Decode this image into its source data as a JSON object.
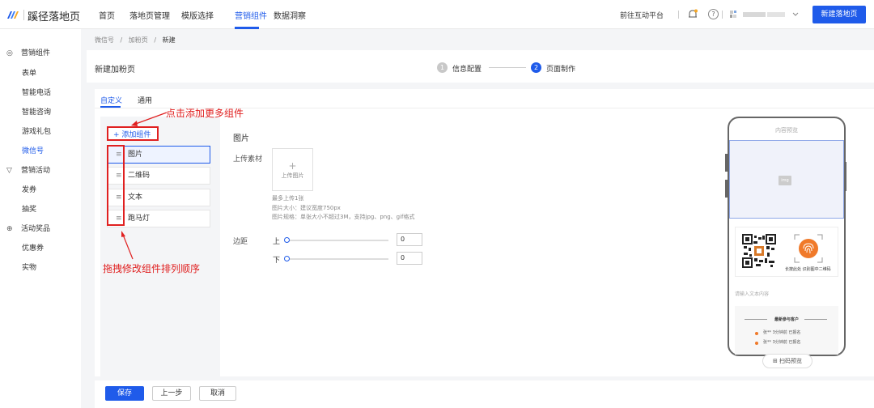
{
  "brand": {
    "name": "蹊径落地页",
    "accent": "#1f5bea",
    "annotation_color": "#e02020"
  },
  "nav": {
    "items": [
      "首页",
      "落地页管理",
      "模版选择",
      "营销组件",
      "数据洞察"
    ],
    "active_index": 3
  },
  "top_right": {
    "platform_link": "前往互动平台",
    "new_button": "新建落地页"
  },
  "sidebar": {
    "groups": [
      {
        "label": "营销组件",
        "icon": "target-icon",
        "items": [
          "表单",
          "智能电话",
          "智能咨询",
          "游戏礼包",
          "微信号"
        ]
      },
      {
        "label": "营销活动",
        "icon": "cup-icon",
        "items": [
          "发券",
          "抽奖"
        ]
      },
      {
        "label": "活动奖品",
        "icon": "gift-icon",
        "items": [
          "优惠券",
          "实物"
        ]
      }
    ],
    "active_item": "微信号"
  },
  "breadcrumb": {
    "items": [
      "微信号",
      "加粉页",
      "新建"
    ],
    "separator": "/"
  },
  "page_title": "新建加粉页",
  "steps": [
    {
      "num": "1",
      "label": "信息配置",
      "state": "done"
    },
    {
      "num": "2",
      "label": "页面制作",
      "state": "active"
    }
  ],
  "tabs": {
    "items": [
      "自定义",
      "通用"
    ],
    "active_index": 0
  },
  "components": {
    "add_button": "+ 添加组件",
    "items": [
      "图片",
      "二维码",
      "文本",
      "跑马灯"
    ],
    "active_index": 0
  },
  "annotations": {
    "add_more": "点击添加更多组件",
    "drag_sort": "拖拽修改组件排列顺序"
  },
  "editor": {
    "section_title": "图片",
    "upload_label": "上传素材",
    "upload_button": "上传图片",
    "hints": [
      "最多上传1张",
      "图片大小：建议宽度750px",
      "图片规格：单张大小不超过3M，支持jpg、png、gif格式"
    ],
    "margin_label": "边距",
    "margin_top_label": "上",
    "margin_bottom_label": "下",
    "margin_top_value": "0",
    "margin_bottom_value": "0"
  },
  "preview": {
    "title": "内容预览",
    "image_placeholder": "img",
    "qr_caption": "长按此处 识别图中二维码",
    "text_placeholder": "请输入文本内容",
    "recent_title": "最新参与客户",
    "recent_rows": [
      "张**  3分钟前  已报名",
      "张**  3分钟前  已报名"
    ],
    "scan_button": "扫码预览"
  },
  "footer": {
    "save": "保存",
    "prev": "上一步",
    "cancel": "取消"
  }
}
